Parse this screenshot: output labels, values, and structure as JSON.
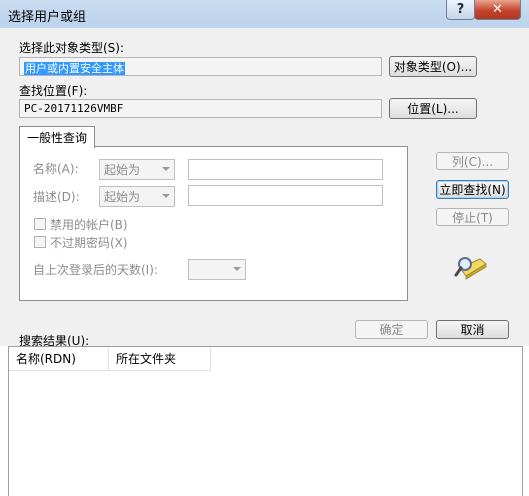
{
  "window": {
    "title": "选择用户或组",
    "help_glyph": "?",
    "close_glyph": "✕"
  },
  "object_type": {
    "label": "选择此对象类型(S):",
    "value": "用户或内置安全主体",
    "button": "对象类型(O)..."
  },
  "location": {
    "label": "查找位置(F):",
    "value": "PC-20171126VMBF",
    "button": "位置(L)..."
  },
  "tab": {
    "label": "一般性查询"
  },
  "query": {
    "name_label": "名称(A):",
    "name_combo": "起始为",
    "desc_label": "描述(D):",
    "desc_combo": "起始为",
    "disabled_accounts": "禁用的帐户(B)",
    "nonexpiring_password": "不过期密码(X)",
    "days_label": "自上次登录后的天数(I):",
    "days_value": ""
  },
  "side_buttons": {
    "columns": "列(C)...",
    "find_now": "立即查找(N)",
    "stop": "停止(T)"
  },
  "footer": {
    "ok": "确定",
    "cancel": "取消"
  },
  "results": {
    "label": "搜索结果(U):",
    "columns": [
      "名称(RDN)",
      "所在文件夹"
    ]
  },
  "icons": {
    "help": "help-icon",
    "close": "close-icon",
    "search": "magnifier-search-icon"
  }
}
